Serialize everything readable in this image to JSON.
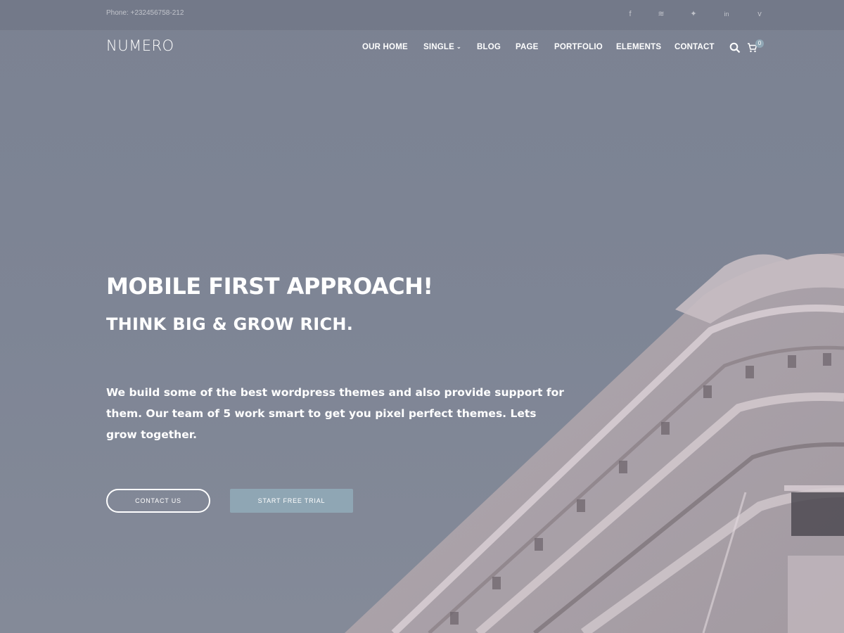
{
  "topbar": {
    "phone": "Phone: +232456758-212",
    "social": [
      {
        "icon": "facebook-icon",
        "glyph": "f"
      },
      {
        "icon": "rss-icon",
        "glyph": "≋"
      },
      {
        "icon": "twitter-icon",
        "glyph": "✦"
      },
      {
        "icon": "linkedin-icon",
        "glyph": "in"
      },
      {
        "icon": "vimeo-icon",
        "glyph": "v"
      }
    ]
  },
  "nav": {
    "logo": "NUMERO",
    "items": [
      "OUR HOME",
      "SINGLE",
      "BLOG",
      "PAGE",
      "PORTFOLIO",
      "ELEMENTS",
      "CONTACT"
    ],
    "cart_count": "0"
  },
  "hero": {
    "headline": "MOBILE FIRST APPROACH!",
    "subhead": "THINK BIG & GROW RICH.",
    "paragraph": "We build some of the best wordpress themes and also provide support for them. Our team of 5 work smart to get you pixel perfect themes. Lets grow together.",
    "primary_button": "CONTACT US",
    "secondary_button": "START FREE TRIAL"
  },
  "colors": {
    "overlay": "#7d8493",
    "accent": "#8fa6b4"
  }
}
